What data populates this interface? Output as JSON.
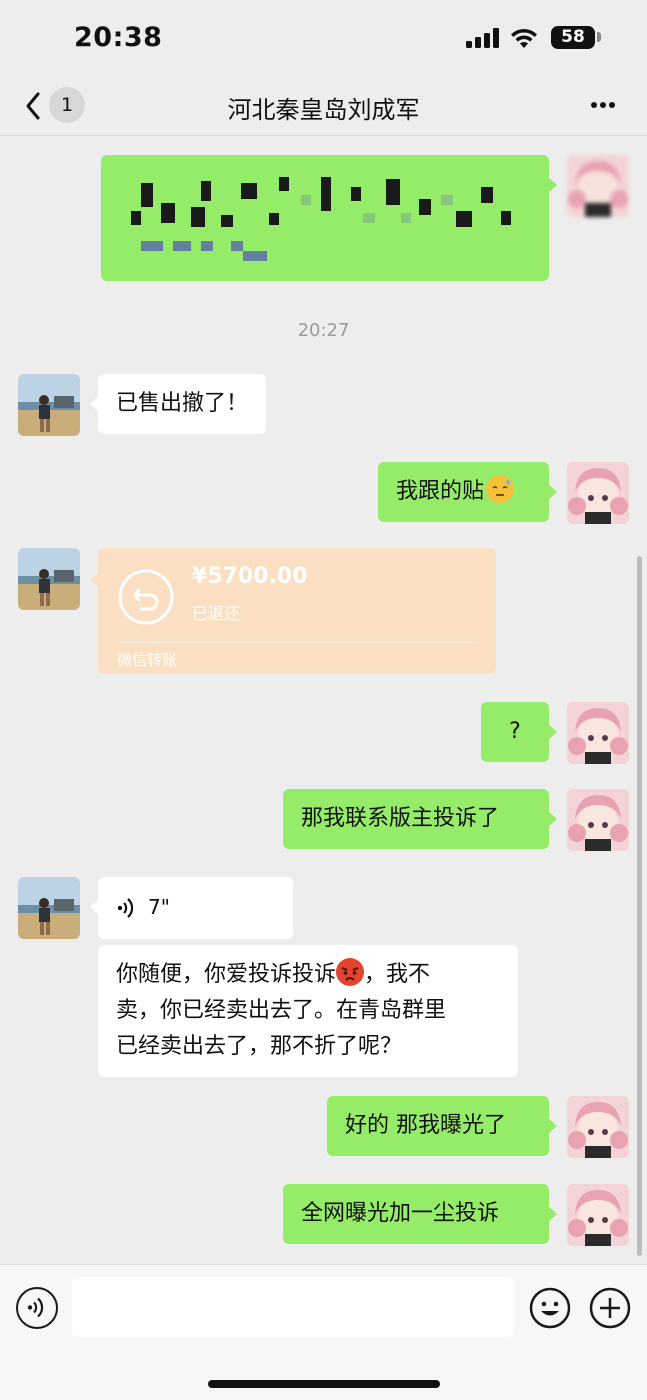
{
  "status_bar": {
    "time": "20:38",
    "battery": "58"
  },
  "nav": {
    "unread_count": "1",
    "title": "河北秦皇岛刘成军"
  },
  "timestamp": "20:27",
  "messages": {
    "m1": "已售出撤了！",
    "m2": "我跟的贴",
    "m3": "?",
    "m4": "那我联系版主投诉了",
    "m5_line1": "你随便，你爱投诉投诉",
    "m5_line1b": "，我不",
    "m5_line2": "卖，你已经卖出去了。在青岛群里",
    "m5_line3": "已经卖出去了，那不折了呢？",
    "m6": "好的 那我曝光了",
    "m7": "全网曝光加一尘投诉"
  },
  "transfer": {
    "amount": "¥5700.00",
    "status": "已退还",
    "label": "微信转账"
  },
  "voice": {
    "duration": "7\""
  },
  "colors": {
    "sent_bubble": "#95ec69",
    "received_bubble": "#ffffff",
    "transfer_card": "#fbdfc2",
    "background": "#ededed"
  },
  "icons": [
    "back-icon",
    "more-icon",
    "signal-icon",
    "wifi-icon",
    "battery-icon",
    "refund-icon",
    "voice-icon",
    "emoji-icon",
    "plus-icon",
    "voice-input-icon"
  ]
}
